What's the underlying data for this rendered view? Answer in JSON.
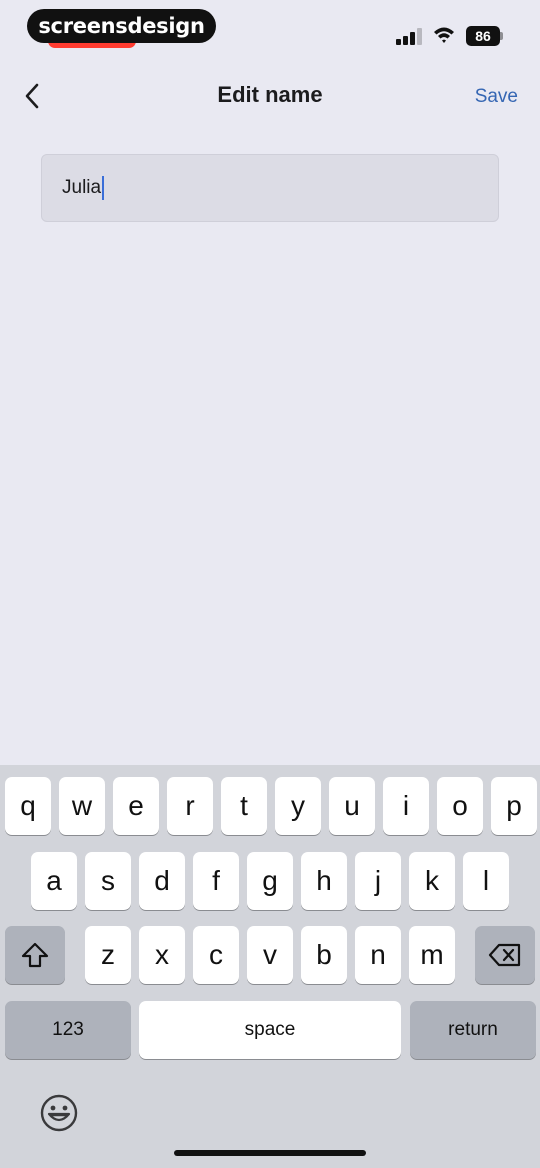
{
  "status": {
    "brand": "screensdesign",
    "battery": "86"
  },
  "nav": {
    "title": "Edit name",
    "save_label": "Save"
  },
  "field": {
    "value": "Julia"
  },
  "keyboard": {
    "row1": [
      "q",
      "w",
      "e",
      "r",
      "t",
      "y",
      "u",
      "i",
      "o",
      "p"
    ],
    "row2": [
      "a",
      "s",
      "d",
      "f",
      "g",
      "h",
      "j",
      "k",
      "l"
    ],
    "row3": [
      "z",
      "x",
      "c",
      "v",
      "b",
      "n",
      "m"
    ],
    "numbers_label": "123",
    "space_label": "space",
    "return_label": "return"
  },
  "colors": {
    "background": "#e9e9f2",
    "accent": "#3566b3",
    "keyboard": "#d2d4da"
  }
}
